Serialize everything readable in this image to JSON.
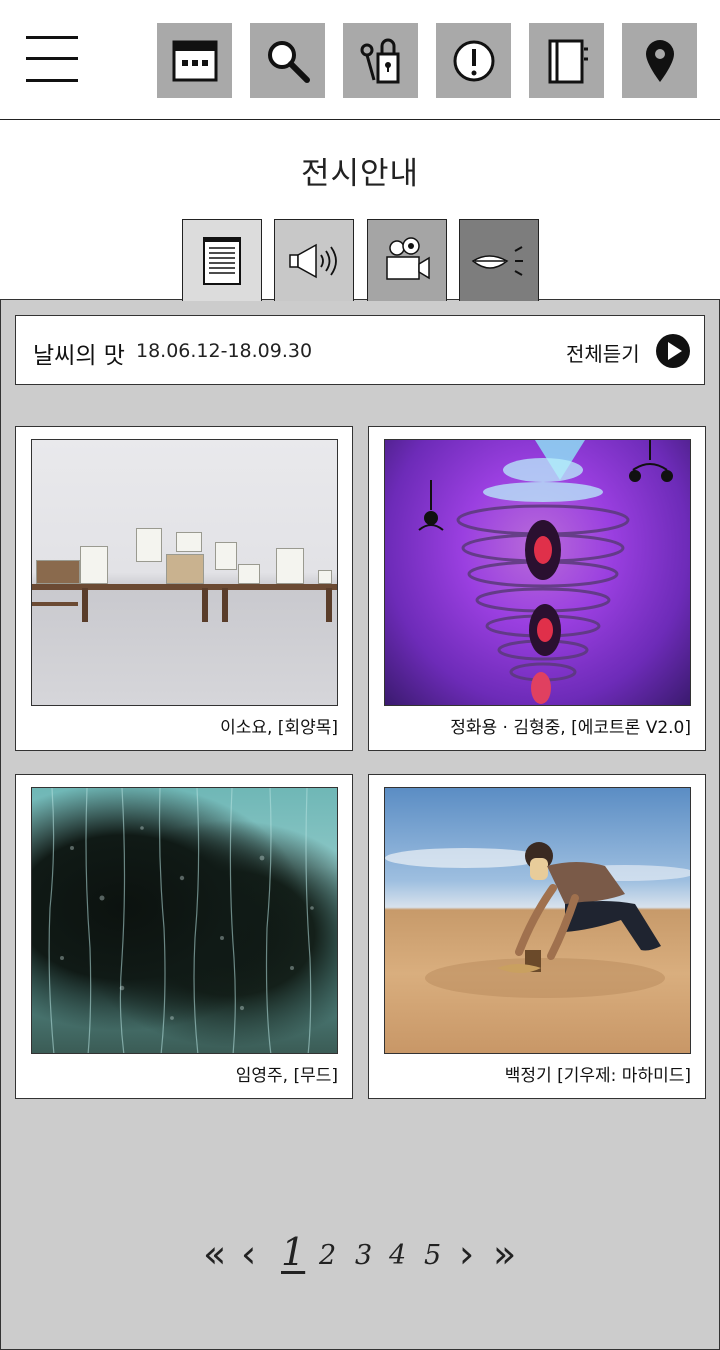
{
  "header": {
    "icons": [
      "calendar-icon",
      "search-icon",
      "locker-key-icon",
      "info-icon",
      "notebook-icon",
      "location-pin-icon"
    ]
  },
  "page": {
    "title": "전시안내"
  },
  "tabs": [
    {
      "icon": "document-icon",
      "color": "#dcdcdc"
    },
    {
      "icon": "speaker-icon",
      "color": "#c8c8c8"
    },
    {
      "icon": "video-camera-icon",
      "color": "#a5a5a5"
    },
    {
      "icon": "sign-language-icon",
      "color": "#7d7d7d"
    }
  ],
  "exhibition": {
    "name": "날씨의 맛",
    "dates": "18.06.12-18.09.30",
    "listen_all_label": "전체듣기"
  },
  "artworks": [
    {
      "caption": "이소요, [회양목]"
    },
    {
      "caption": "정화용 · 김형중, [에코트론 V2.0]"
    },
    {
      "caption": "임영주, [무드]"
    },
    {
      "caption": "백정기 [기우제: 마하미드]"
    }
  ],
  "pagination": {
    "first": "«",
    "prev": "‹",
    "pages": [
      "1",
      "2",
      "3",
      "4",
      "5"
    ],
    "current": "1",
    "next": "›",
    "last": "»"
  },
  "colors": {
    "content_bg": "#cccccc",
    "icon_bg": "#a9a9a9"
  }
}
